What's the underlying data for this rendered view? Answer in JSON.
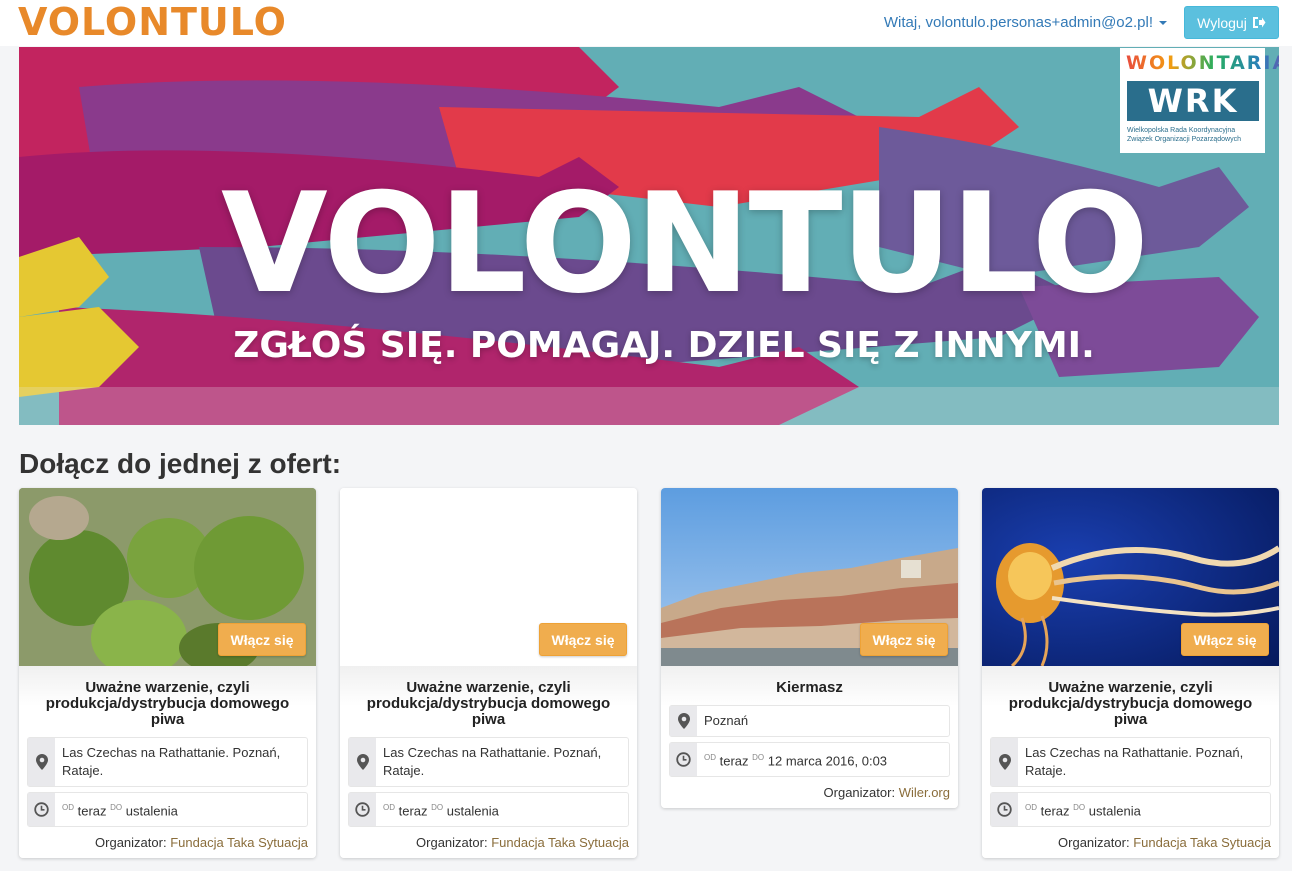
{
  "navbar": {
    "brand": "VOLONTULO",
    "greeting": "Witaj, volontulo.personas+admin@o2.pl!",
    "logout_label": "Wyloguj"
  },
  "banner": {
    "title": "VOLONTULO",
    "subtitle": "ZGŁOŚ SIĘ. POMAGAJ. DZIEL SIĘ Z INNYMI.",
    "partner_logo": {
      "top": "WOLONTARIAT",
      "mark": "WRK",
      "caption_line1": "Wielkopolska Rada Koordynacyjna",
      "caption_line2": "Związek Organizacji Pozarządowych"
    }
  },
  "section_title": "Dołącz do jednej z ofert:",
  "labels": {
    "join": "Włącz się",
    "from": "od",
    "to": "do",
    "organizer": "Organizator:"
  },
  "offers": [
    {
      "title": "Uważne warzenie, czyli produkcja/dystrybucja domowego piwa",
      "location": "Las Czechas na Rathattanie. Poznań, Rataje.",
      "start": "teraz",
      "end": "ustalenia",
      "organizer": "Fundacja Taka Sytuacja",
      "image": "hops"
    },
    {
      "title": "Uważne warzenie, czyli produkcja/dystrybucja domowego piwa",
      "location": "Las Czechas na Rathattanie. Poznań, Rataje.",
      "start": "teraz",
      "end": "ustalenia",
      "organizer": "Fundacja Taka Sytuacja",
      "image": "blank"
    },
    {
      "title": "Kiermasz",
      "location": "Poznań",
      "start": "teraz",
      "end": "12 marca 2016, 0:03",
      "organizer": "Wiler.org",
      "image": "city"
    },
    {
      "title": "Uważne warzenie, czyli produkcja/dystrybucja domowego piwa",
      "location": "Las Czechas na Rathattanie. Poznań, Rataje.",
      "start": "teraz",
      "end": "ustalenia",
      "organizer": "Fundacja Taka Sytuacja",
      "image": "jellyfish"
    }
  ],
  "colors": {
    "brand_orange": "#e8892a",
    "link_blue": "#337ab7",
    "logout_bg": "#5bc0de",
    "join_bg": "#f0ad4e",
    "organizer_link": "#8a6d3b"
  }
}
